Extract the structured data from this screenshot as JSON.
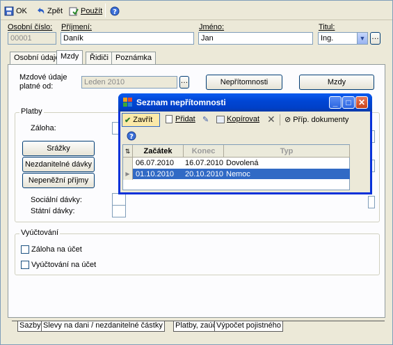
{
  "toolbar": {
    "ok_label": "OK",
    "back_label": "Zpět",
    "apply_label": "Použít"
  },
  "header": {
    "personal_number_label": "Osobní číslo:",
    "personal_number_value": "00001",
    "surname_label": "Příjmení:",
    "surname_value": "Daník",
    "name_label": "Jméno:",
    "name_value": "Jan",
    "title_label": "Titul:",
    "title_value": "Ing."
  },
  "tabs": [
    "Osobní údaje",
    "Mzdy",
    "Řidiči",
    "Poznámka"
  ],
  "mzdy": {
    "period_label_line1": "Mzdové údaje",
    "period_label_line2": "platné od:",
    "period_value": "Leden 2010",
    "absence_button": "Nepřítomnosti",
    "wages_button": "Mzdy"
  },
  "payments": {
    "group_title": "Platby",
    "advance_label": "Záloha:",
    "deductions_button": "Srážky",
    "nontaxable_button": "Nezdanitelné dávky",
    "noncash_button": "Nepeněžní příjmy",
    "social_label": "Sociální dávky:",
    "state_label": "Státní dávky:"
  },
  "settlement": {
    "group_title": "Vyúčtování",
    "advance_to_account": "Záloha na účet",
    "settlement_to_account": "Vyúčtování na účet"
  },
  "bottom_tabs": [
    "Sazby",
    "Slevy na dani / nezdanitelné částky",
    "Platby, zaúčtování",
    "Výpočet pojistného"
  ],
  "dialog": {
    "title": "Seznam nepřítomnosti",
    "close_label": "Zavřít",
    "add_label": "Přidat",
    "copy_label": "Kopírovat",
    "attachments_label": "Příp. dokumenty",
    "columns": [
      "Začátek",
      "Konec",
      "Typ"
    ],
    "rows": [
      {
        "start": "06.07.2010",
        "end": "16.07.2010",
        "type": "Dovolená"
      },
      {
        "start": "01.10.2010",
        "end": "20.10.2010",
        "type": "Nemoc"
      }
    ]
  }
}
